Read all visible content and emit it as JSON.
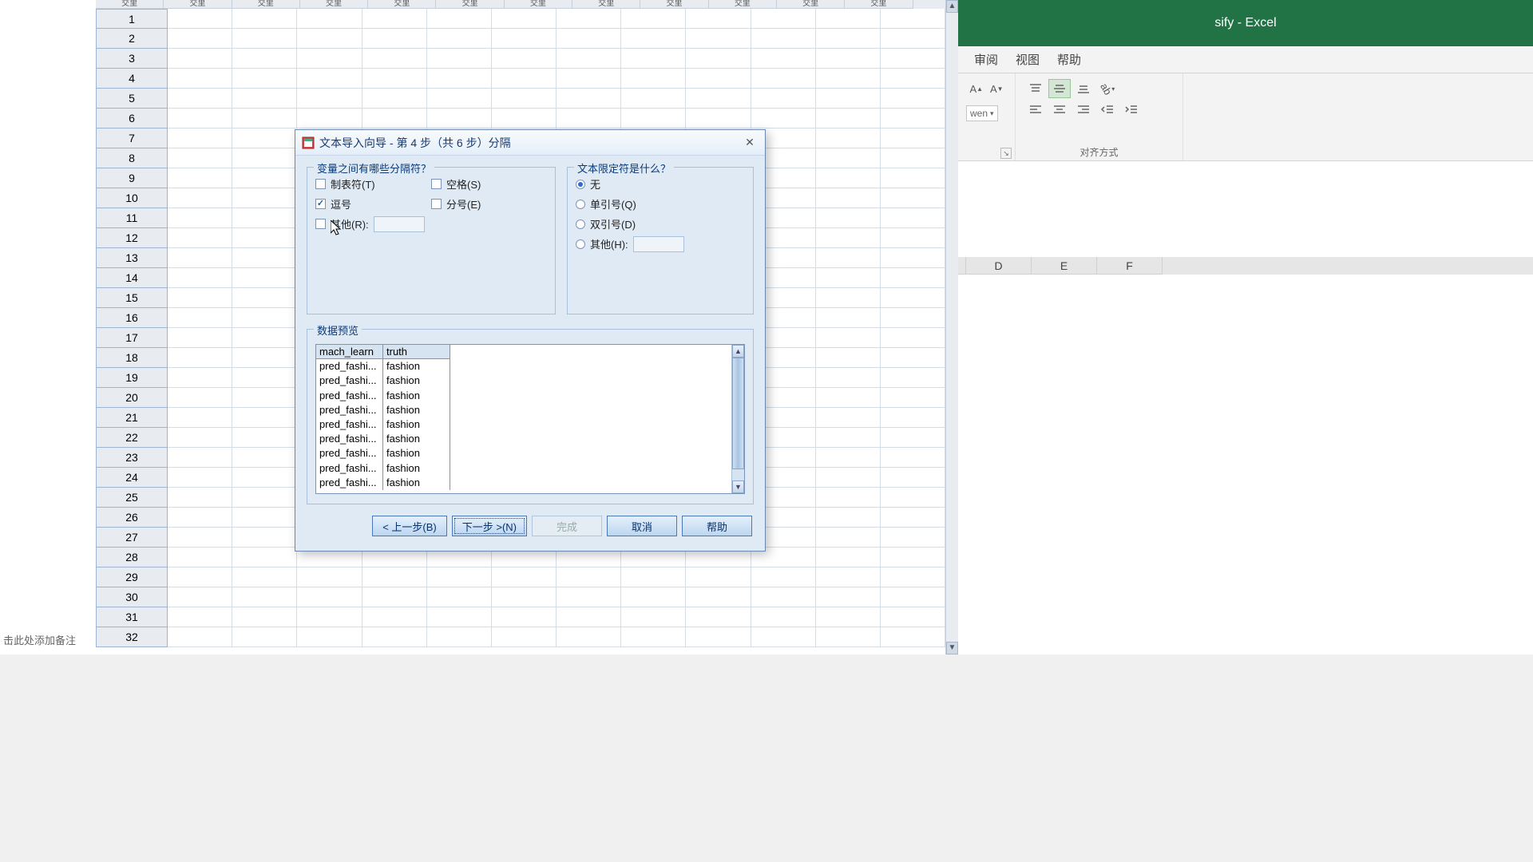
{
  "spreadsheet": {
    "col_header_text": "交里",
    "rows": [
      "1",
      "2",
      "3",
      "4",
      "5",
      "6",
      "7",
      "8",
      "9",
      "10",
      "11",
      "12",
      "13",
      "14",
      "15",
      "16",
      "17",
      "18",
      "19",
      "20",
      "21",
      "22",
      "23",
      "24",
      "25",
      "26",
      "27",
      "28",
      "29",
      "30",
      "31",
      "32"
    ],
    "footer": "击此处添加备注"
  },
  "dialog": {
    "title": "文本导入向导 - 第 4 步（共 6 步）分隔",
    "delim_legend": "变量之间有哪些分隔符？",
    "qual_legend": "文本限定符是什么？",
    "checks": {
      "tab": "制表符(T)",
      "space": "空格(S)",
      "comma": "逗号",
      "semicolon": "分号(E)",
      "other": "其他(R):"
    },
    "radios": {
      "none": "无",
      "single": "单引号(Q)",
      "double": "双引号(D)",
      "other": "其他(H):"
    },
    "preview_legend": "数据预览",
    "preview": {
      "headers": [
        "mach_learn",
        "truth"
      ],
      "rows": [
        [
          "pred_fashi...",
          "fashion"
        ],
        [
          "pred_fashi...",
          "fashion"
        ],
        [
          "pred_fashi...",
          "fashion"
        ],
        [
          "pred_fashi...",
          "fashion"
        ],
        [
          "pred_fashi...",
          "fashion"
        ],
        [
          "pred_fashi...",
          "fashion"
        ],
        [
          "pred_fashi...",
          "fashion"
        ],
        [
          "pred_fashi...",
          "fashion"
        ],
        [
          "pred_fashi...",
          "fashion"
        ]
      ]
    },
    "buttons": {
      "back": "< 上一步(B)",
      "next": "下一步 >(N)",
      "finish": "完成",
      "cancel": "取消",
      "help": "帮助"
    }
  },
  "excel": {
    "title": "sify  -  Excel",
    "tabs": [
      "审阅",
      "视图",
      "帮助"
    ],
    "align_group": "对齐方式",
    "wen": "wen",
    "cols": [
      "D",
      "E",
      "F"
    ]
  }
}
